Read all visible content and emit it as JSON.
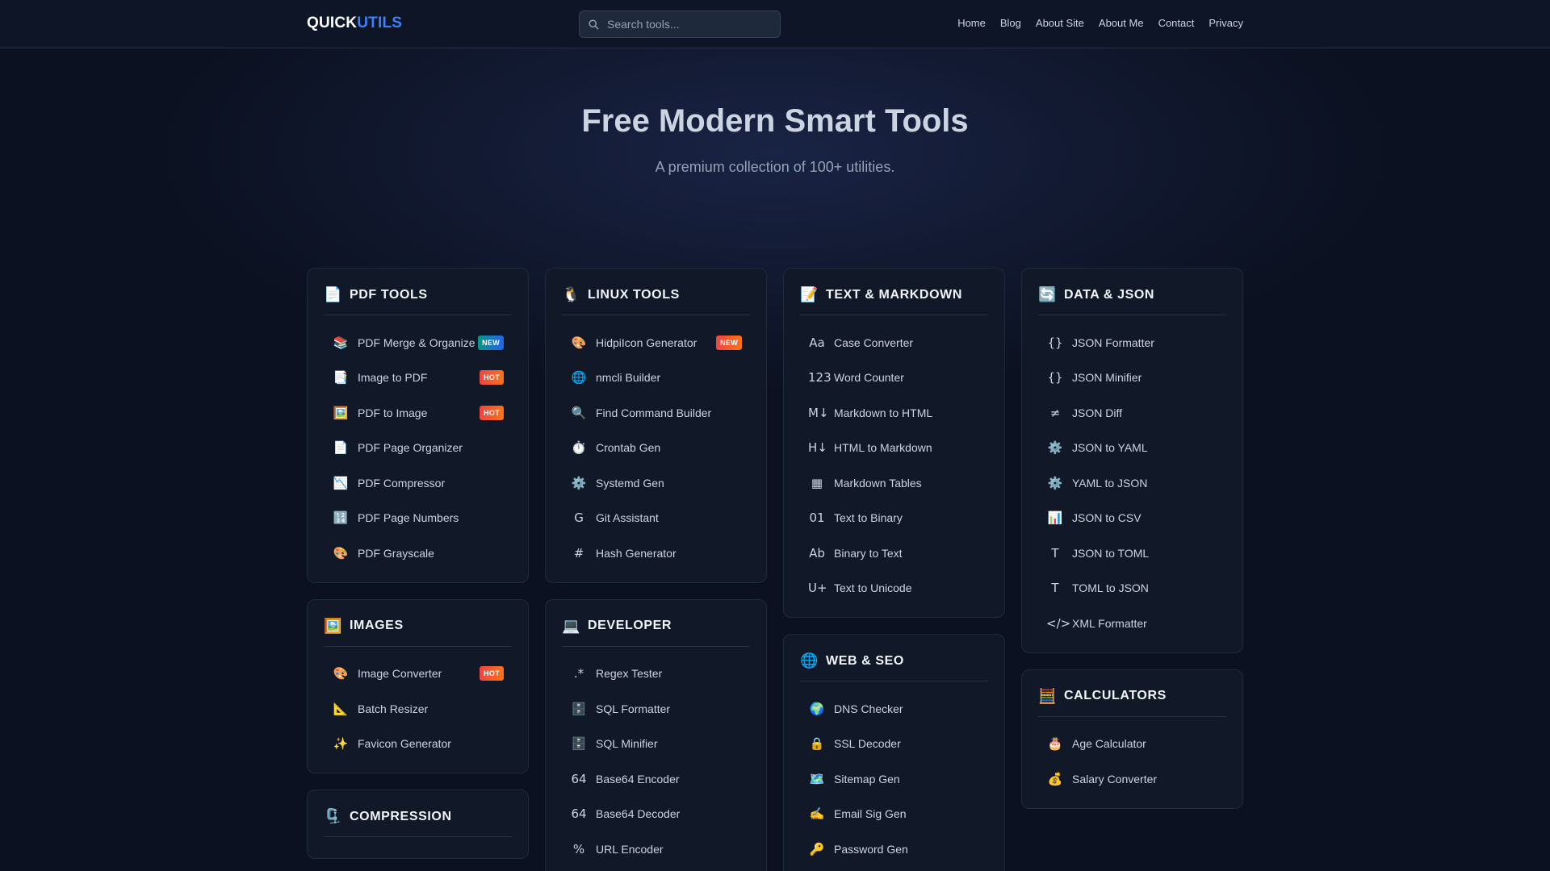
{
  "nav": {
    "logo_part1": "QUICK",
    "logo_part2": "UTILS",
    "search_placeholder": "Search tools...",
    "links": [
      "Home",
      "Blog",
      "About Site",
      "About Me",
      "Contact",
      "Privacy"
    ]
  },
  "hero": {
    "title": "Free Modern Smart Tools",
    "subtitle": "A premium collection of 100+ utilities."
  },
  "colors": {
    "accent": "#3b82f6",
    "background": "#0b1120",
    "card": "#111827",
    "hot_badge": "#f97316",
    "new_badge": "#0d9488"
  },
  "columns": [
    {
      "cards": [
        {
          "id": "pdf-tools",
          "icon": "📄",
          "icon_name": "document-icon",
          "title": "PDF TOOLS",
          "items": [
            {
              "icon": "📚",
              "icon_name": "books-icon",
              "label": "PDF Merge & Organize",
              "badge": "NEW",
              "badge_style": "new-teal"
            },
            {
              "icon": "📑",
              "icon_name": "bookmark-tabs-icon",
              "label": "Image to PDF",
              "badge": "HOT",
              "badge_style": "hot"
            },
            {
              "icon": "🖼️",
              "icon_name": "framed-picture-icon",
              "label": "PDF to Image",
              "badge": "HOT",
              "badge_style": "hot"
            },
            {
              "icon": "📄",
              "icon_name": "page-icon",
              "label": "PDF Page Organizer"
            },
            {
              "icon": "📉",
              "icon_name": "chart-decreasing-icon",
              "label": "PDF Compressor"
            },
            {
              "icon": "🔢",
              "icon_name": "numbers-icon",
              "label": "PDF Page Numbers"
            },
            {
              "icon": "🎨",
              "icon_name": "palette-icon",
              "label": "PDF Grayscale"
            }
          ]
        },
        {
          "id": "images",
          "icon": "🖼️",
          "icon_name": "framed-picture-icon",
          "title": "IMAGES",
          "items": [
            {
              "icon": "🎨",
              "icon_name": "palette-icon",
              "label": "Image Converter",
              "badge": "HOT",
              "badge_style": "hot"
            },
            {
              "icon": "📐",
              "icon_name": "triangular-ruler-icon",
              "label": "Batch Resizer"
            },
            {
              "icon": "✨",
              "icon_name": "sparkles-icon",
              "label": "Favicon Generator"
            }
          ]
        },
        {
          "id": "compression",
          "icon": "🗜️",
          "icon_name": "clamp-icon",
          "title": "COMPRESSION",
          "items": []
        }
      ]
    },
    {
      "cards": [
        {
          "id": "linux-tools",
          "icon": "🐧",
          "icon_name": "penguin-icon",
          "title": "LINUX TOOLS",
          "items": [
            {
              "icon": "🎨",
              "icon_name": "palette-icon",
              "label": "HidpiIcon Generator",
              "badge": "NEW",
              "badge_style": "new-orange"
            },
            {
              "icon": "🌐",
              "icon_name": "globe-icon",
              "label": "nmcli Builder"
            },
            {
              "icon": "🔍",
              "icon_name": "magnifier-icon",
              "label": "Find Command Builder"
            },
            {
              "icon": "⏱️",
              "icon_name": "stopwatch-icon",
              "label": "Crontab Gen"
            },
            {
              "icon": "⚙️",
              "icon_name": "gear-icon",
              "label": "Systemd Gen"
            },
            {
              "icon": "G",
              "icon_name": "git-icon",
              "label": "Git Assistant"
            },
            {
              "icon": "#",
              "icon_name": "hash-icon",
              "label": "Hash Generator"
            }
          ]
        },
        {
          "id": "developer",
          "icon": "💻",
          "icon_name": "laptop-icon",
          "title": "DEVELOPER",
          "items": [
            {
              "icon": ".*",
              "icon_name": "regex-icon",
              "label": "Regex Tester"
            },
            {
              "icon": "🗄️",
              "icon_name": "file-cabinet-icon",
              "label": "SQL Formatter"
            },
            {
              "icon": "🗄️",
              "icon_name": "file-cabinet-icon",
              "label": "SQL Minifier"
            },
            {
              "icon": "64",
              "icon_name": "base64-icon",
              "label": "Base64 Encoder"
            },
            {
              "icon": "64",
              "icon_name": "base64-icon",
              "label": "Base64 Decoder"
            },
            {
              "icon": "%",
              "icon_name": "percent-icon",
              "label": "URL Encoder"
            }
          ]
        }
      ]
    },
    {
      "cards": [
        {
          "id": "text-markdown",
          "icon": "📝",
          "icon_name": "memo-icon",
          "title": "TEXT & MARKDOWN",
          "items": [
            {
              "icon": "Aa",
              "icon_name": "case-icon",
              "label": "Case Converter"
            },
            {
              "icon": "123",
              "icon_name": "count-icon",
              "label": "Word Counter"
            },
            {
              "icon": "M↓",
              "icon_name": "markdown-icon",
              "label": "Markdown to HTML"
            },
            {
              "icon": "H↓",
              "icon_name": "html-icon",
              "label": "HTML to Markdown"
            },
            {
              "icon": "▦",
              "icon_name": "table-icon",
              "label": "Markdown Tables"
            },
            {
              "icon": "01",
              "icon_name": "binary-icon",
              "label": "Text to Binary"
            },
            {
              "icon": "Ab",
              "icon_name": "text-icon",
              "label": "Binary to Text"
            },
            {
              "icon": "U+",
              "icon_name": "unicode-icon",
              "label": "Text to Unicode"
            }
          ]
        },
        {
          "id": "web-seo",
          "icon": "🌐",
          "icon_name": "globe-icon",
          "title": "WEB & SEO",
          "items": [
            {
              "icon": "🌍",
              "icon_name": "earth-icon",
              "label": "DNS Checker"
            },
            {
              "icon": "🔒",
              "icon_name": "lock-icon",
              "label": "SSL Decoder"
            },
            {
              "icon": "🗺️",
              "icon_name": "map-icon",
              "label": "Sitemap Gen"
            },
            {
              "icon": "✍️",
              "icon_name": "writing-hand-icon",
              "label": "Email Sig Gen"
            },
            {
              "icon": "🔑",
              "icon_name": "key-icon",
              "label": "Password Gen"
            }
          ]
        }
      ]
    },
    {
      "cards": [
        {
          "id": "data-json",
          "icon": "🔄",
          "icon_name": "refresh-icon",
          "title": "DATA & JSON",
          "items": [
            {
              "icon": "{}",
              "icon_name": "braces-icon",
              "label": "JSON Formatter"
            },
            {
              "icon": "{}",
              "icon_name": "braces-icon",
              "label": "JSON Minifier"
            },
            {
              "icon": "≠",
              "icon_name": "not-equal-icon",
              "label": "JSON Diff"
            },
            {
              "icon": "⚙️",
              "icon_name": "gear-icon",
              "label": "JSON to YAML"
            },
            {
              "icon": "⚙️",
              "icon_name": "gear-icon",
              "label": "YAML to JSON"
            },
            {
              "icon": "📊",
              "icon_name": "bar-chart-icon",
              "label": "JSON to CSV"
            },
            {
              "icon": "T",
              "icon_name": "toml-icon",
              "label": "JSON to TOML"
            },
            {
              "icon": "T",
              "icon_name": "toml-icon",
              "label": "TOML to JSON"
            },
            {
              "icon": "</>",
              "icon_name": "code-icon",
              "label": "XML Formatter"
            }
          ]
        },
        {
          "id": "calculators",
          "icon": "🧮",
          "icon_name": "abacus-icon",
          "title": "CALCULATORS",
          "items": [
            {
              "icon": "🎂",
              "icon_name": "birthday-cake-icon",
              "label": "Age Calculator"
            },
            {
              "icon": "💰",
              "icon_name": "money-bag-icon",
              "label": "Salary Converter"
            }
          ]
        }
      ]
    }
  ]
}
